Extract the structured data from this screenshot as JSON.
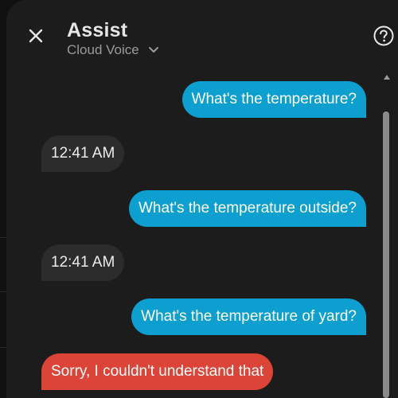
{
  "dialog": {
    "title": "Assist",
    "pipeline": "Cloud Voice"
  },
  "icons": {
    "close": "close-icon",
    "chevron": "chevron-down-icon",
    "help": "help-circle-icon"
  },
  "colors": {
    "user_bubble": "#0d9fd0",
    "agent_bubble": "#2c2c2c",
    "error_bubble": "#db4437",
    "dialog_bg": "#1c1c1c"
  },
  "messages": [
    {
      "from": "user",
      "text": "What's the temperature?"
    },
    {
      "from": "agent",
      "text": "12:41 AM"
    },
    {
      "from": "user",
      "text": "What's the temperature outside?"
    },
    {
      "from": "agent",
      "text": "12:41 AM"
    },
    {
      "from": "user",
      "text": "What's the temperature of yard?"
    },
    {
      "from": "agent-error",
      "text": "Sorry, I couldn't understand that"
    }
  ]
}
